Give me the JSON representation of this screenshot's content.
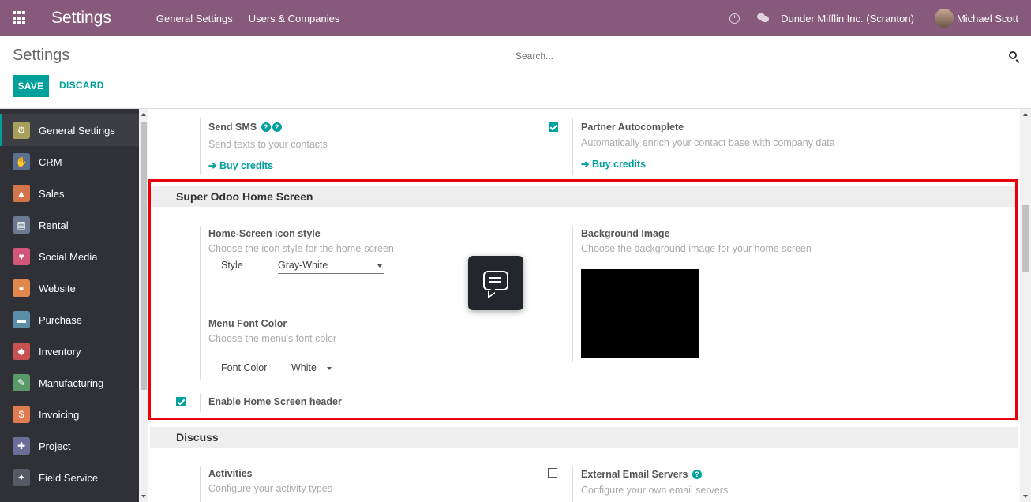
{
  "navbar": {
    "brand": "Settings",
    "menu": [
      "General Settings",
      "Users & Companies"
    ],
    "company": "Dunder Mifflin Inc. (Scranton)",
    "user": "Michael Scott"
  },
  "control_panel": {
    "breadcrumb": "Settings",
    "search_placeholder": "Search...",
    "save_label": "SAVE",
    "discard_label": "DISCARD"
  },
  "sidebar": {
    "items": [
      {
        "label": "General Settings",
        "icon": "gear-icon",
        "color": "#a7a05a"
      },
      {
        "label": "CRM",
        "icon": "handshake-icon",
        "color": "#5b6f8f"
      },
      {
        "label": "Sales",
        "icon": "chart-icon",
        "color": "#d4744b"
      },
      {
        "label": "Rental",
        "icon": "rental-icon",
        "color": "#6b7a8f"
      },
      {
        "label": "Social Media",
        "icon": "thumbs-up-icon",
        "color": "#d2557a"
      },
      {
        "label": "Website",
        "icon": "globe-icon",
        "color": "#e0874b"
      },
      {
        "label": "Purchase",
        "icon": "purchase-icon",
        "color": "#5b8fa8"
      },
      {
        "label": "Inventory",
        "icon": "inventory-icon",
        "color": "#c8524f"
      },
      {
        "label": "Manufacturing",
        "icon": "wrench-icon",
        "color": "#5a9a6a"
      },
      {
        "label": "Invoicing",
        "icon": "invoice-icon",
        "color": "#e07a4f"
      },
      {
        "label": "Project",
        "icon": "puzzle-icon",
        "color": "#6a6f9a"
      },
      {
        "label": "Field Service",
        "icon": "field-service-icon",
        "color": "#555a66"
      }
    ]
  },
  "top_settings": {
    "send_sms": {
      "title": "Send SMS",
      "desc": "Send texts to your contacts",
      "link": "Buy credits"
    },
    "partner_autocomplete": {
      "title": "Partner Autocomplete",
      "desc": "Automatically enrich your contact base with company data",
      "link": "Buy credits",
      "checked": true
    }
  },
  "home_screen": {
    "header": "Super Odoo Home Screen",
    "icon_style": {
      "title": "Home-Screen icon style",
      "desc": "Choose the icon style for the home-screen",
      "field_label": "Style",
      "value": "Gray-White"
    },
    "font_color": {
      "title": "Menu Font Color",
      "desc": "Choose the menu's font color",
      "field_label": "Font Color",
      "value": "White"
    },
    "background": {
      "title": "Background Image",
      "desc": "Choose the background image for your home screen"
    },
    "header_toggle": {
      "title": "Enable Home Screen header",
      "checked": true
    }
  },
  "discuss": {
    "header": "Discuss",
    "activities": {
      "title": "Activities",
      "desc": "Configure your activity types"
    },
    "email_servers": {
      "title": "External Email Servers",
      "desc": "Configure your own email servers",
      "checked": false
    }
  },
  "colors": {
    "brand": "#875a7b",
    "accent": "#00a09d",
    "highlight": "#e8000b"
  }
}
